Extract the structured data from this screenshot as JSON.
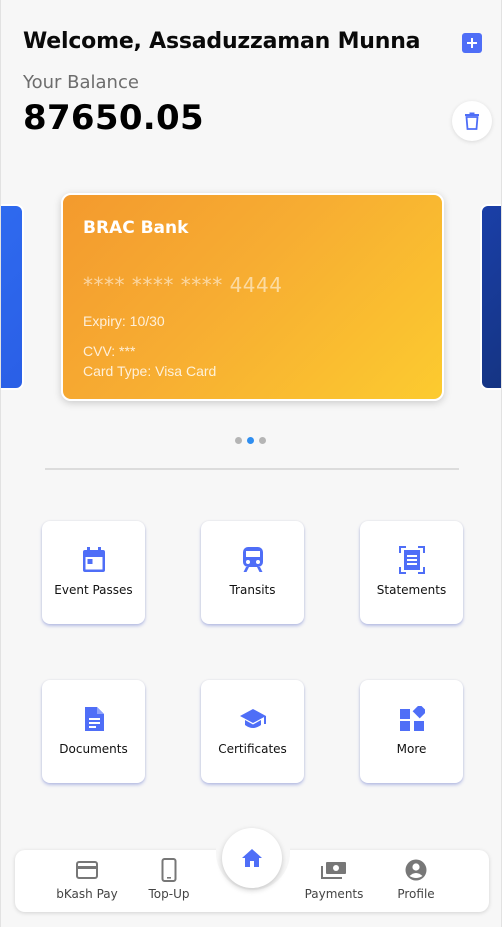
{
  "header": {
    "welcome": "Welcome, Assaduzzaman Munna",
    "balance_label": "Your Balance",
    "balance_value": "87650.05"
  },
  "card": {
    "bank": "BRAC Bank",
    "number": "**** **** **** 4444",
    "expiry": "Expiry: 10/30",
    "cvv": "CVV: ***",
    "type": "Card Type: Visa Card"
  },
  "carousel": {
    "count": 3,
    "active_index": 1
  },
  "services": [
    {
      "label": "Event Passes",
      "icon": "calendar-icon"
    },
    {
      "label": "Transits",
      "icon": "train-icon"
    },
    {
      "label": "Statements",
      "icon": "receipt-icon"
    },
    {
      "label": "Documents",
      "icon": "document-icon"
    },
    {
      "label": "Certificates",
      "icon": "graduation-cap-icon"
    },
    {
      "label": "More",
      "icon": "widgets-icon"
    }
  ],
  "nav": {
    "bkash": "bKash Pay",
    "topup": "Top-Up",
    "payments": "Payments",
    "profile": "Profile"
  },
  "colors": {
    "accent": "#4f6ef7",
    "card_gradient_start": "#f39a2e",
    "card_gradient_end": "#fccb2f",
    "dot_active": "#2f8ef0"
  }
}
